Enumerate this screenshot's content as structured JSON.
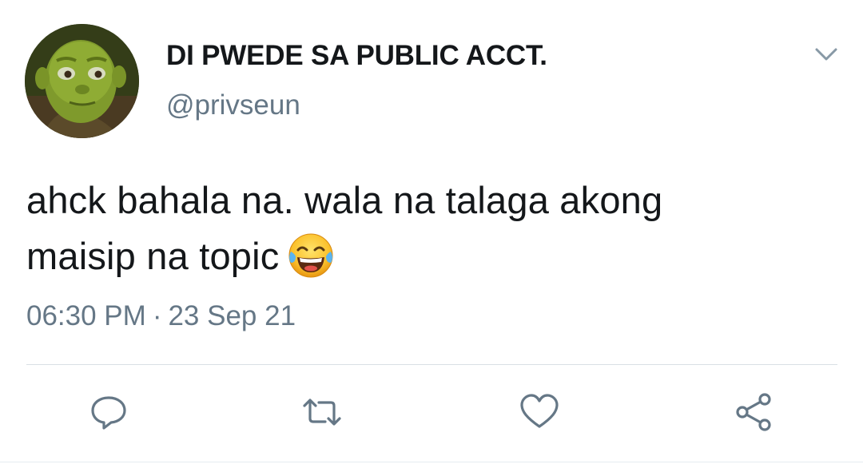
{
  "user": {
    "display_name": "DI PWEDE SA PUBLIC ACCT.",
    "handle": "@privseun",
    "avatar_icon": "avatar-image"
  },
  "tweet": {
    "text_line1": "ahck bahala na. wala na talaga akong",
    "text_line2": "maisip na topic",
    "emoji": "face-with-tears-of-joy",
    "time": "06:30 PM",
    "separator": "·",
    "date": "23 Sep 21"
  },
  "actions": {
    "reply_icon": "reply-icon",
    "retweet_icon": "retweet-icon",
    "like_icon": "heart-icon",
    "share_icon": "share-icon"
  },
  "colors": {
    "text": "#14171a",
    "secondary": "#657786",
    "icon": "#657786",
    "divider": "#d9e0e4"
  }
}
